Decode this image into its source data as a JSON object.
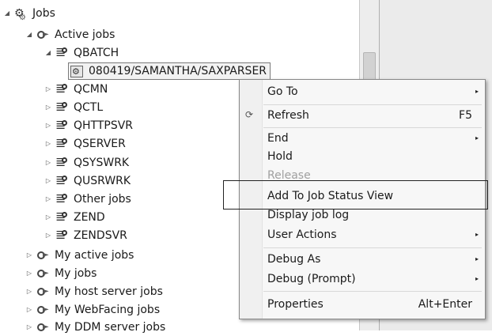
{
  "tree": {
    "jobs": "Jobs",
    "active_jobs": "Active jobs",
    "qbatch": "QBATCH",
    "selected_job": "080419/SAMANTHA/SAXPARSER",
    "subsystems": [
      "QCMN",
      "QCTL",
      "QHTTPSVR",
      "QSERVER",
      "QSYSWRK",
      "QUSRWRK",
      "Other jobs",
      "ZEND",
      "ZENDSVR"
    ],
    "filters": [
      "My active jobs",
      "My jobs",
      "My host server jobs",
      "My WebFacing jobs",
      "My DDM server jobs"
    ]
  },
  "context_menu": {
    "go_to": "Go To",
    "refresh": "Refresh",
    "refresh_shortcut": "F5",
    "end": "End",
    "hold": "Hold",
    "release": "Release",
    "add_status_view": "Add To Job Status View",
    "display_log": "Display job log",
    "user_actions": "User Actions",
    "debug_as": "Debug As",
    "debug_prompt": "Debug (Prompt)",
    "properties": "Properties",
    "properties_shortcut": "Alt+Enter",
    "submenu_arrow": "▸",
    "refresh_icon": "refresh-icon"
  }
}
